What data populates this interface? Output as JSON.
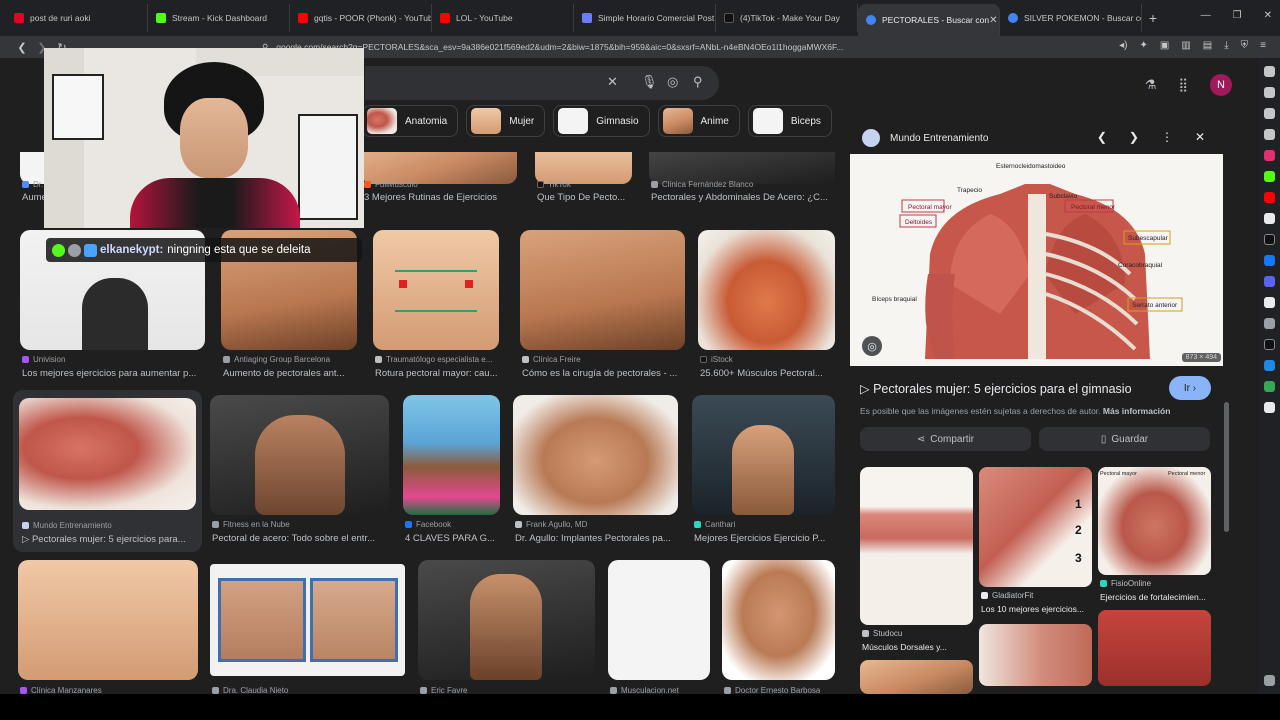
{
  "browser": {
    "tabs": [
      {
        "title": "post de ruri aoki",
        "color": "#e60023"
      },
      {
        "title": "Stream - Kick Dashboard",
        "color": "#53fc18"
      },
      {
        "title": "gqtis - POOR (Phonk) - YouTube",
        "color": "#ff0000"
      },
      {
        "title": "LOL - YouTube",
        "color": "#ff0000"
      },
      {
        "title": "Simple Horario Comercial Post",
        "color": "#6b7cff"
      },
      {
        "title": "(4)TikTok - Make Your Day",
        "color": "#111111"
      },
      {
        "title": "PECTORALES - Buscar con",
        "color": "#4285f4"
      },
      {
        "title": "SILVER POKEMON - Buscar con",
        "color": "#4285f4"
      }
    ],
    "new_tab": "+",
    "url": "google.com/search?q=PECTORALES&sca_esv=9a386e021f569ed2&udm=2&biw=1875&bih=959&aic=0&sxsrf=ANbL-n4eBN4OEo1l1hoggaMWX6F..."
  },
  "google": {
    "avatar_initial": "N",
    "chips": [
      {
        "label": "Anatomia"
      },
      {
        "label": "Mujer"
      },
      {
        "label": "Gimnasio"
      },
      {
        "label": "Anime"
      },
      {
        "label": "Biceps"
      }
    ]
  },
  "results": [
    {
      "source": "Dr.",
      "caption": "Aume"
    },
    {
      "source": "FullMusculo",
      "caption": "3 Mejores Rutinas de Ejercicios"
    },
    {
      "source": "TikTok",
      "caption": "Que Tipo De Pecto..."
    },
    {
      "source": "Clinica Fernández Blanco",
      "caption": "Pectorales y Abdominales De Acero: ¿C..."
    },
    {
      "source": "Univision",
      "caption": "Los mejores ejercicios para aumentar p..."
    },
    {
      "source": "Antiaging Group Barcelona",
      "caption": "Aumento de pectorales ant..."
    },
    {
      "source": "Traumatólogo especialista e...",
      "caption": "Rotura pectoral mayor: cau..."
    },
    {
      "source": "Clínica Freire",
      "caption": "Cómo es la cirugía de pectorales - ..."
    },
    {
      "source": "iStock",
      "caption": "25.600+ Músculos Pectoral..."
    },
    {
      "source": "Mundo Entrenamiento",
      "caption": "▷ Pectorales mujer: 5 ejercicios para..."
    },
    {
      "source": "Fitness en la Nube",
      "caption": "Pectoral de acero: Todo sobre el entr..."
    },
    {
      "source": "Facebook",
      "caption": "4 CLAVES PARA G..."
    },
    {
      "source": "Frank Agullo, MD",
      "caption": "Dr. Agullo: Implantes Pectorales pa..."
    },
    {
      "source": "Canthari",
      "caption": "Mejores Ejercicios Ejercicio P..."
    },
    {
      "source": "Clínica Manzanares",
      "caption": ""
    },
    {
      "source": "Dra. Claudia Nieto",
      "caption": ""
    },
    {
      "source": "Eric Favre",
      "caption": ""
    },
    {
      "source": "Musculacion.net",
      "caption": ""
    },
    {
      "source": "Doctor Ernesto Barbosa",
      "caption": ""
    }
  ],
  "overlay": {
    "chat_user": "elkanekypt:",
    "chat_message": "ningning esta que se deleita"
  },
  "preview": {
    "site": "Mundo Entrenamiento",
    "dimensions": "873 × 494",
    "title": "▷ Pectorales mujer: 5 ejercicios para el gimnasio",
    "visit_label": "Ir",
    "copyright": "Es posible que las imágenes estén sujetas a derechos de autor.",
    "more_info": "Más información",
    "share_label": "Compartir",
    "save_label": "Guardar",
    "anatomy_labels": {
      "l1": "Esternocleidomastoideo",
      "l2": "Trapecio",
      "l3": "Subclavio",
      "l4": "Pectoral mayor",
      "l5": "Pectoral menor",
      "l6": "Deltoides",
      "l7": "Subescapular",
      "l8": "Coracobraquial",
      "l9": "Bíceps braquial",
      "l10": "Serrato anterior"
    },
    "thumb_labels": {
      "num1": "1",
      "num2": "2",
      "num3": "3",
      "pmayor": "Pectoral mayor",
      "pmenor": "Pectoral menor"
    },
    "related": [
      {
        "source": "Studocu",
        "caption": "Músculos Dorsales y..."
      },
      {
        "source": "GladiatorFit",
        "caption": "Los 10 mejores ejercicios..."
      },
      {
        "source": "FisioOnline",
        "caption": "Ejercicios de fortalecimien..."
      }
    ]
  }
}
